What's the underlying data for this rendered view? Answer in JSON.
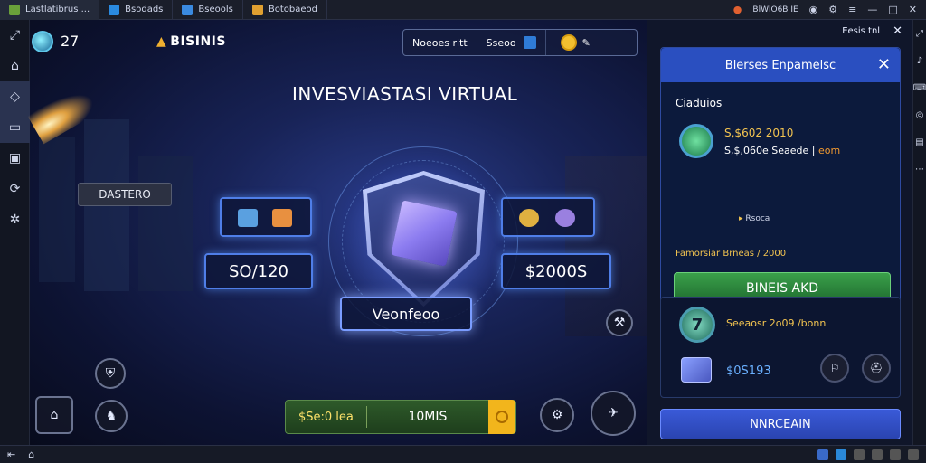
{
  "tabs": [
    {
      "label": "Lastlatibrus ..."
    },
    {
      "label": "Bsodads"
    },
    {
      "label": "Bseools"
    },
    {
      "label": "Botobaeod"
    }
  ],
  "system": {
    "status_text": "BlWlO6B IE"
  },
  "hud": {
    "level": "27",
    "brand": "BISINIS",
    "topbox_label": "Noeoes ritt",
    "topbox_value": "Sseoo"
  },
  "game": {
    "title": "INVESVIASTASI VIRTUAL",
    "side_label": "DASTERO",
    "left_value": "SO/120",
    "right_value": "$2000S",
    "center_button": "Veonfeoo",
    "bottom_left": "$Se:0 lea",
    "bottom_right": "10MIS"
  },
  "sidepanel": {
    "header": "Eesis tnl",
    "card_title": "Blerses Enpamelsc",
    "section": "Ciaduios",
    "val1": "S,$602 2010",
    "val2": "S,$,060e Seaede |",
    "val2_suffix": "eom",
    "note": "Rsoca",
    "line": "Famorsiar Brneas / 2000",
    "green_button": "BINEIS AKD",
    "card2_badge": "7",
    "card2_title": "Seeaosr 2o09 /bonn",
    "card2_value": "$0S193",
    "blue_button": "NNRCEAIN"
  }
}
